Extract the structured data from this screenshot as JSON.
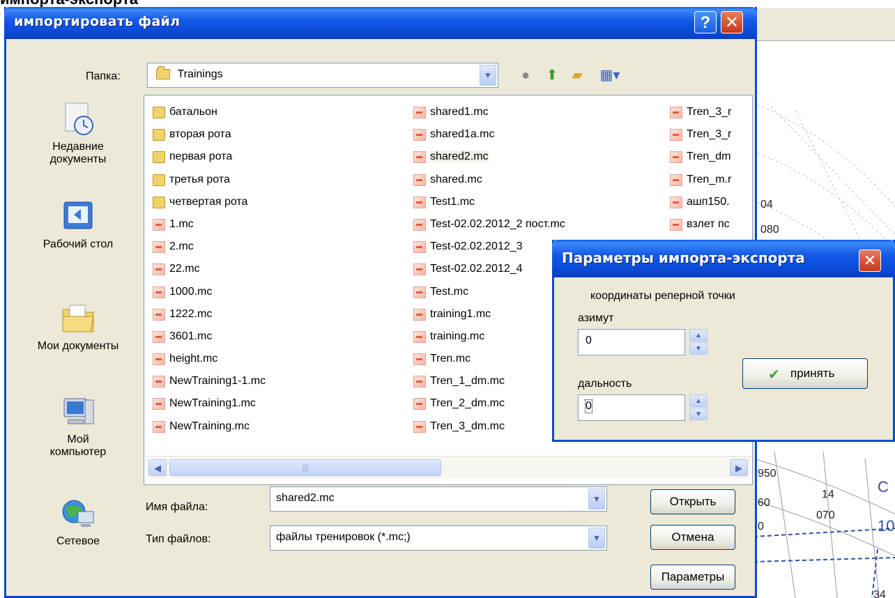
{
  "page_caption": "импорта-экспорта",
  "dialog": {
    "title": "импортировать файл",
    "help_label": "?",
    "close_label": "✕",
    "folder_label": "Папка:",
    "folder_value": "Trainings",
    "file_name_label": "Имя файла:",
    "file_name_value": "shared2.mc",
    "file_type_label": "Тип файлов:",
    "file_type_value": "файлы тренировок (*.mc;)",
    "open_button": "Открыть",
    "cancel_button": "Отмена",
    "params_button": "Параметры"
  },
  "places": [
    {
      "label": "Недавние документы",
      "icon": "recent-documents-icon"
    },
    {
      "label": "Рабочий стол",
      "icon": "desktop-icon"
    },
    {
      "label": "Мои документы",
      "icon": "my-documents-icon"
    },
    {
      "label": "Мой компьютер",
      "icon": "my-computer-icon"
    },
    {
      "label": "Сетевое",
      "icon": "network-icon"
    }
  ],
  "files": {
    "col1": [
      {
        "name": "батальон",
        "type": "folder"
      },
      {
        "name": "вторая рота",
        "type": "folder"
      },
      {
        "name": "первая рота",
        "type": "folder"
      },
      {
        "name": "третья рота",
        "type": "folder"
      },
      {
        "name": "четвертая рота",
        "type": "folder"
      },
      {
        "name": "1.mc",
        "type": "mc"
      },
      {
        "name": "2.mc",
        "type": "mc"
      },
      {
        "name": "22.mc",
        "type": "mc"
      },
      {
        "name": "1000.mc",
        "type": "mc"
      },
      {
        "name": "1222.mc",
        "type": "mc"
      },
      {
        "name": "3601.mc",
        "type": "mc"
      },
      {
        "name": "height.mc",
        "type": "mc"
      },
      {
        "name": "NewTraining1-1.mc",
        "type": "mc"
      },
      {
        "name": "NewTraining1.mc",
        "type": "mc"
      },
      {
        "name": "NewTraining.mc",
        "type": "mc"
      }
    ],
    "col2": [
      {
        "name": "shared1.mc",
        "type": "mc"
      },
      {
        "name": "shared1a.mc",
        "type": "mc"
      },
      {
        "name": "shared2.mc",
        "type": "mc",
        "selected": true
      },
      {
        "name": "shared.mc",
        "type": "mc"
      },
      {
        "name": "Test1.mc",
        "type": "mc"
      },
      {
        "name": "Test-02.02.2012_2 пост.mc",
        "type": "mc"
      },
      {
        "name": "Test-02.02.2012_3",
        "type": "mc"
      },
      {
        "name": "Test-02.02.2012_4",
        "type": "mc"
      },
      {
        "name": "Test.mc",
        "type": "mc"
      },
      {
        "name": "training1.mc",
        "type": "mc"
      },
      {
        "name": "training.mc",
        "type": "mc"
      },
      {
        "name": "Tren.mc",
        "type": "mc"
      },
      {
        "name": "Tren_1_dm.mc",
        "type": "mc"
      },
      {
        "name": "Tren_2_dm.mc",
        "type": "mc"
      },
      {
        "name": "Tren_3_dm.mc",
        "type": "mc"
      }
    ],
    "col3": [
      {
        "name": "Tren_3_r",
        "type": "mc"
      },
      {
        "name": "Tren_3_r",
        "type": "mc"
      },
      {
        "name": "Tren_dm",
        "type": "mc"
      },
      {
        "name": "Tren_m.r",
        "type": "mc"
      },
      {
        "name": "ашп150.",
        "type": "mc"
      },
      {
        "name": "взлет пс",
        "type": "mc"
      }
    ]
  },
  "params_dialog": {
    "title": "Параметры импорта-экспорта",
    "close_label": "✕",
    "section_label": "координаты реперной точки",
    "azimuth_label": "азимут",
    "azimuth_value": "0",
    "range_label": "дальность",
    "range_value": "0",
    "accept_button": "принять"
  },
  "radar": {
    "labels": [
      "04",
      "080",
      "950",
      "14",
      "070",
      "10",
      "60",
      "0",
      "С",
      "34"
    ]
  }
}
